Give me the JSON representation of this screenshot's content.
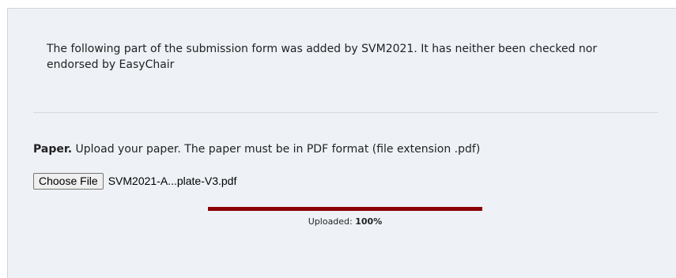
{
  "notice": {
    "text": "The following part of the submission form was added by SVM2021. It has neither been checked nor endorsed by EasyChair"
  },
  "paper": {
    "label": "Paper.",
    "instructions": " Upload your paper. The paper must be in PDF format (file extension .pdf)"
  },
  "file_input": {
    "button_label": "Choose File",
    "file_name": "SVM2021-A...plate-V3.pdf"
  },
  "upload": {
    "status_label": "Uploaded: ",
    "percent_text": "100%",
    "progress_fraction": 1.0,
    "bar_color": "#8b0000"
  },
  "colors": {
    "panel_background": "#eef2f7",
    "accent": "#8b0000"
  }
}
